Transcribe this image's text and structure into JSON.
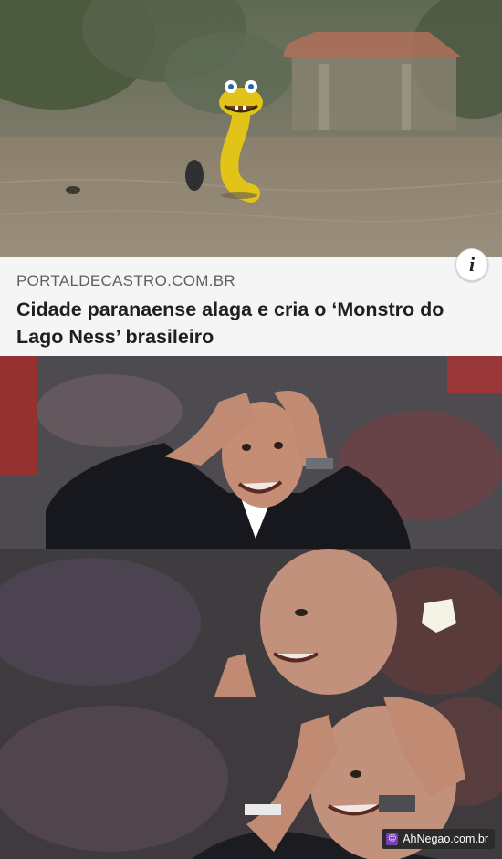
{
  "news_card": {
    "source": "PORTALDECASTRO.COM.BR",
    "headline": "Cidade paranaense alaga e cria o ‘Monstro do Lago Ness’ brasileiro",
    "info_icon": "i"
  },
  "watermark": {
    "text": "AhNegao.com.br",
    "icon": "smiley-icon"
  },
  "colors": {
    "caption_background": "#f5f5f5",
    "headline_text": "#1f1f1f",
    "source_text": "#606060",
    "serpent_yellow": "#e2c419",
    "watermark_accent": "#7a3fb8"
  }
}
